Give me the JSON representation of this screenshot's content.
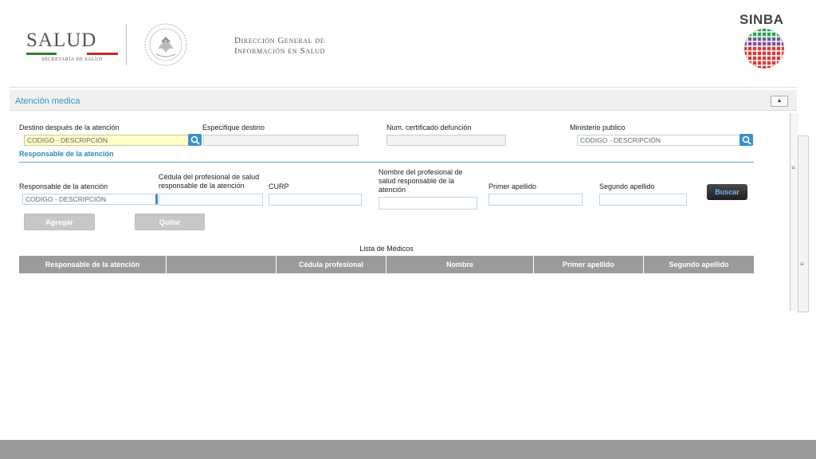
{
  "header": {
    "salud_title": "SALUD",
    "salud_subtitle": "SECRETARÍA DE SALUD",
    "dgis_line1": "Dirección General de",
    "dgis_line2": "Información en Salud",
    "sinba_title": "SINBA"
  },
  "panel": {
    "title": "Atención medica",
    "collapse_symbol": "▲"
  },
  "form": {
    "destino_label": "Destino después de la atención",
    "destino_value": "CODIGO - DESCRIPCIÓN",
    "especifique_label": "Especifique destino",
    "especifique_value": "",
    "num_cert_label": "Num. certificado defunción",
    "num_cert_value": "",
    "ministerio_label": "Ministerio publico",
    "ministerio_value": "CODIGO - DESCRIPCIÓN"
  },
  "responsable_section": {
    "title": "Responsable de la atención",
    "responsable_label": "Responsable de la atención",
    "responsable_value": "CODIGO - DESCRIPCIÓN",
    "cedula_label_line1": "Cédula del profesional de salud",
    "cedula_label_line2": "responsable de la atención",
    "curp_label": "CURP",
    "nombre_label_line1": "Nombre del profesional de",
    "nombre_label_line2": "salud responsable de la",
    "nombre_label_line3": "atención",
    "primer_label": "Primer apellido",
    "segundo_label": "Segundo apellido",
    "buscar_label": "Buscar",
    "agregar_label": "Agregar",
    "quitar_label": "Quitar"
  },
  "list": {
    "title": "Lista de Médicos",
    "columns": [
      "Responsable de la atención",
      "",
      "Cédula profesional",
      "Nombre",
      "Primer apellido",
      "Segundo apellido"
    ]
  }
}
